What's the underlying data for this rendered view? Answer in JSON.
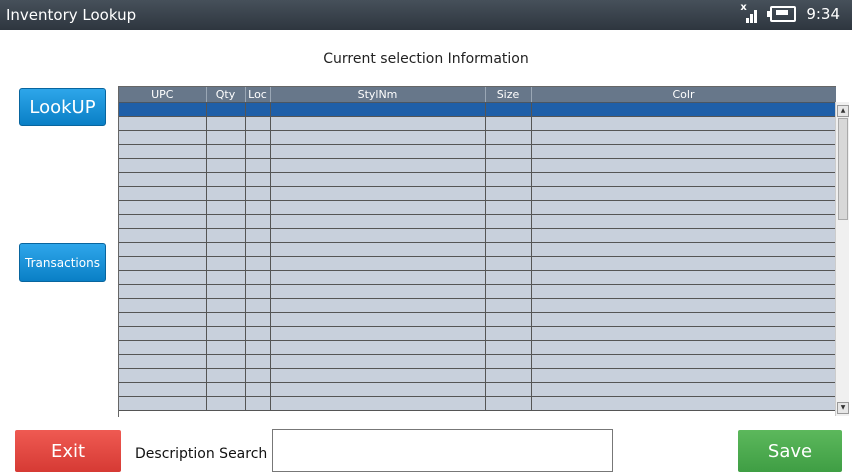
{
  "window": {
    "title": "Inventory Lookup",
    "time": "9:34"
  },
  "heading": "Current selection Information",
  "buttons": {
    "lookup": "LookUP",
    "transactions": "Transactions",
    "exit": "Exit",
    "save": "Save"
  },
  "search": {
    "label": "Description Search",
    "value": ""
  },
  "grid": {
    "columns": [
      {
        "key": "upc",
        "label": "UPC"
      },
      {
        "key": "qty",
        "label": "Qty"
      },
      {
        "key": "loc",
        "label": "Loc"
      },
      {
        "key": "stylnm",
        "label": "StylNm"
      },
      {
        "key": "size",
        "label": "Size"
      },
      {
        "key": "colr",
        "label": "Colr"
      }
    ],
    "selected_row": 0,
    "row_count": 22,
    "rows": []
  },
  "colors": {
    "header_bg": "#67778a",
    "cell_bg": "#c8d0dc",
    "selected_row": "#1f5fa8",
    "exit": "#e04a43",
    "save": "#4caf50",
    "primary": "#0a88d4"
  },
  "icons": [
    "signal-icon",
    "battery-charging-icon",
    "scroll-up-icon",
    "scroll-down-icon"
  ]
}
